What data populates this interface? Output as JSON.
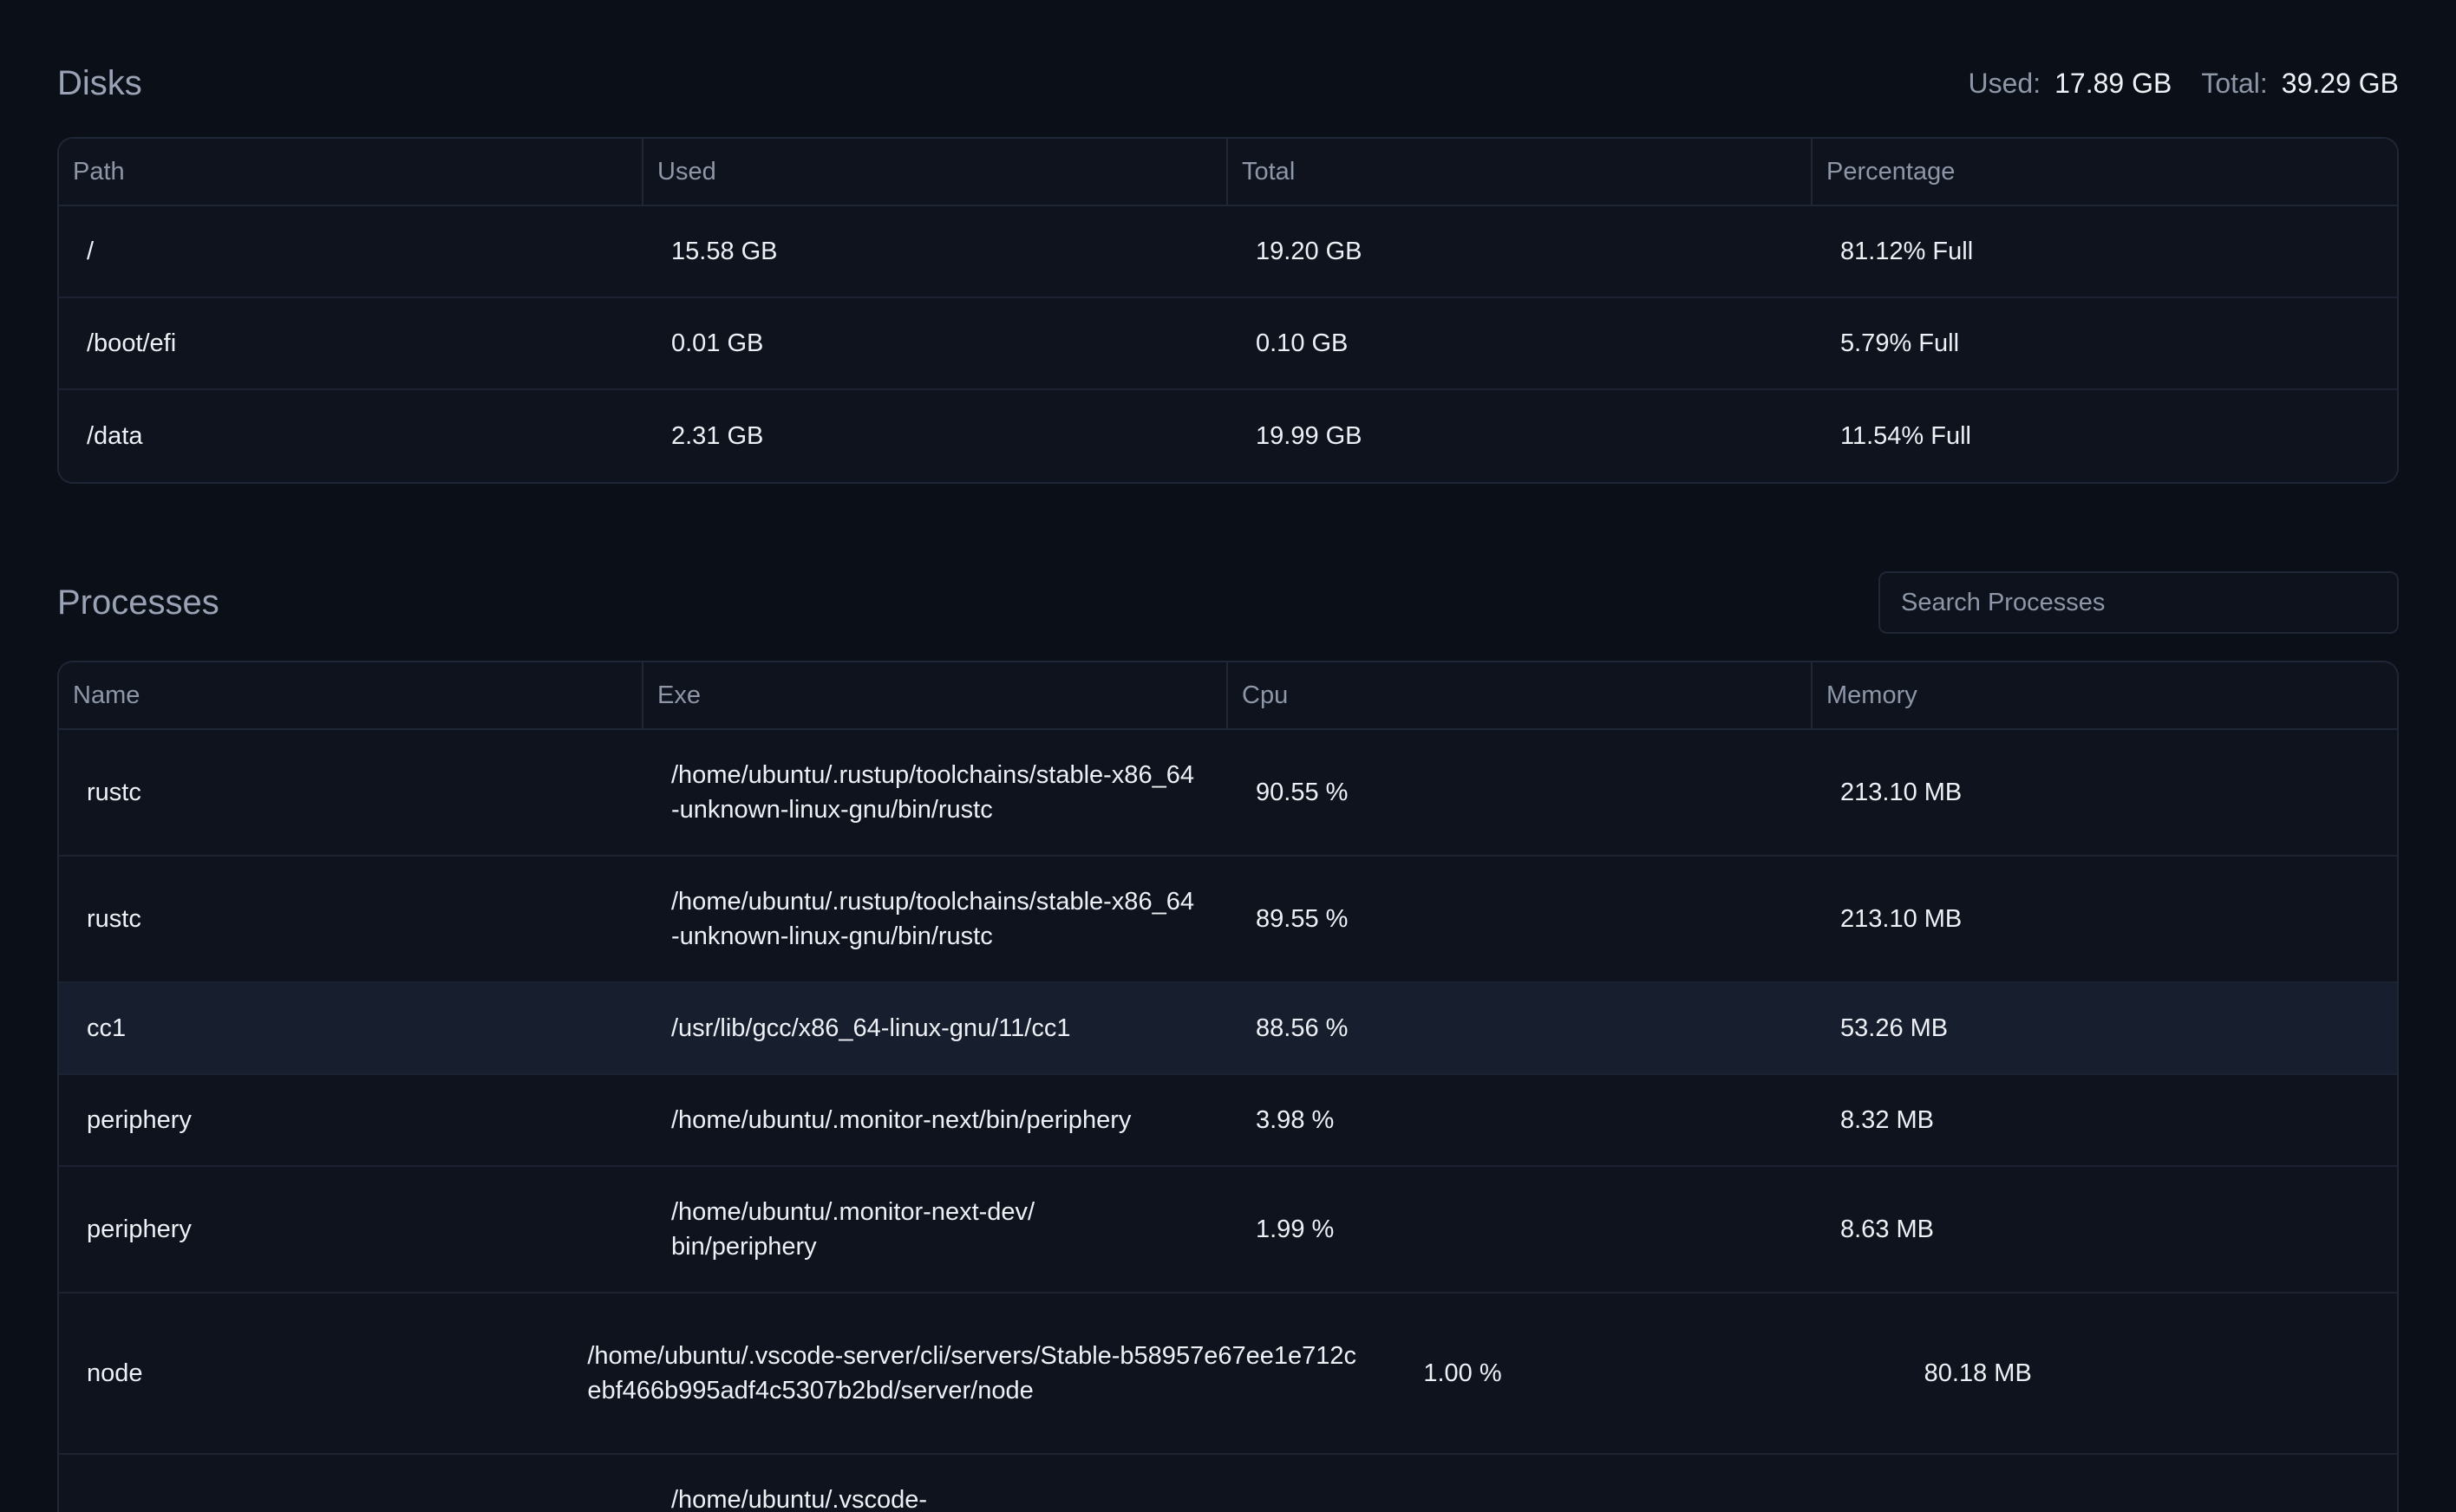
{
  "disks": {
    "title": "Disks",
    "summary": {
      "used_label": "Used:",
      "used_value": "17.89 GB",
      "total_label": "Total:",
      "total_value": "39.29 GB"
    },
    "columns": [
      "Path",
      "Used",
      "Total",
      "Percentage"
    ],
    "rows": [
      {
        "path": "/",
        "used": "15.58 GB",
        "total": "19.20 GB",
        "percentage": "81.12% Full"
      },
      {
        "path": "/boot/efi",
        "used": "0.01 GB",
        "total": "0.10 GB",
        "percentage": "5.79% Full"
      },
      {
        "path": "/data",
        "used": "2.31 GB",
        "total": "19.99 GB",
        "percentage": "11.54% Full"
      }
    ]
  },
  "processes": {
    "title": "Processes",
    "search": {
      "placeholder": "Search Processes",
      "value": ""
    },
    "columns": [
      "Name",
      "Exe",
      "Cpu",
      "Memory"
    ],
    "rows": [
      {
        "name": "rustc",
        "exe": "/home/ubuntu/.rustup/toolchains/stable-x86_64-unknown-linux-gnu/bin/rustc",
        "cpu": "90.55 %",
        "memory": "213.10 MB"
      },
      {
        "name": "rustc",
        "exe": "/home/ubuntu/.rustup/toolchains/stable-x86_64-unknown-linux-gnu/bin/rustc",
        "cpu": "89.55 %",
        "memory": "213.10 MB"
      },
      {
        "name": "cc1",
        "exe": "/usr/lib/gcc/x86_64-linux-gnu/11/cc1",
        "cpu": "88.56 %",
        "memory": "53.26 MB"
      },
      {
        "name": "periphery",
        "exe": "/home/ubuntu/.monitor-next/bin/periphery",
        "cpu": "3.98 %",
        "memory": "8.32 MB"
      },
      {
        "name": "periphery",
        "exe": "/home/ubuntu/.monitor-next-dev/bin/periphery",
        "cpu": "1.99 %",
        "memory": "8.63 MB"
      },
      {
        "name": "node",
        "exe": "/home/ubuntu/.vscode-server/cli/servers/Stable-b58957e67ee1e712cebf466b995adf4c5307b2bd/server/node",
        "cpu": "1.00 %",
        "memory": "80.18 MB"
      },
      {
        "name": "",
        "exe": "/home/ubuntu/.vscode-",
        "cpu": "",
        "memory": ""
      }
    ]
  }
}
